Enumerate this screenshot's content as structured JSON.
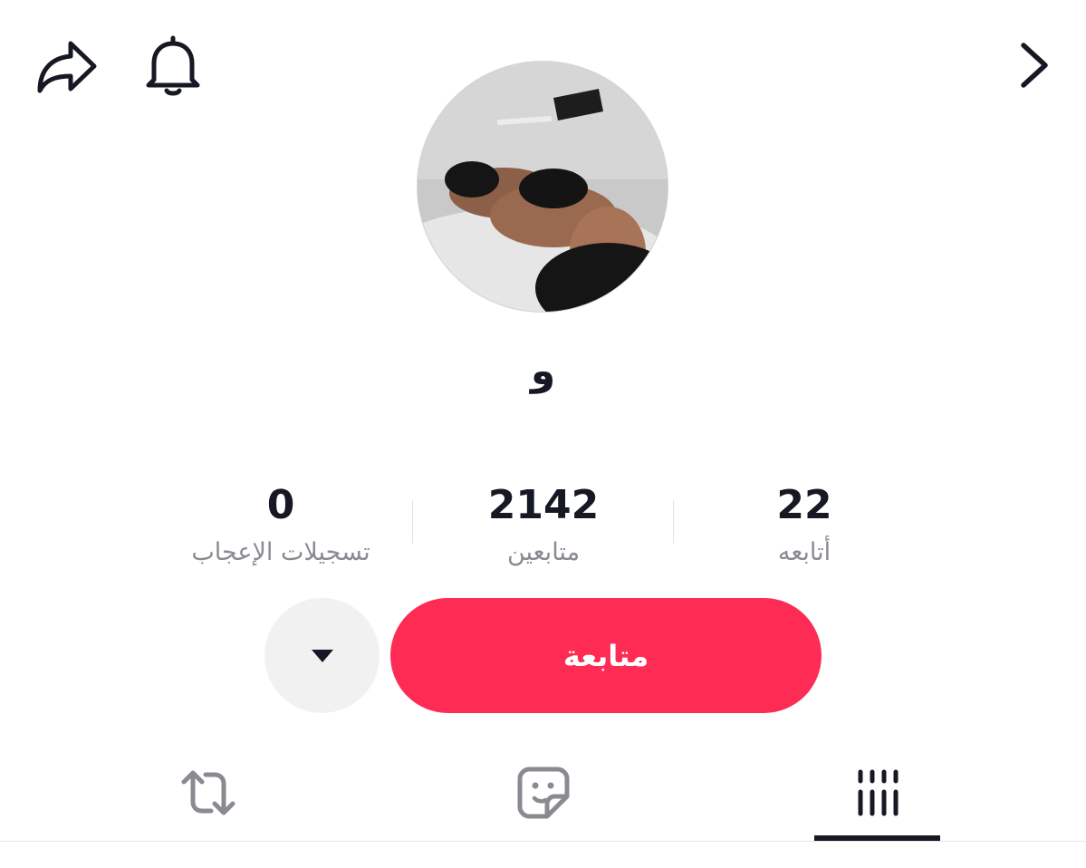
{
  "header": {
    "share_icon": "share-arrow-icon",
    "bell_icon": "bell-icon",
    "back_icon": "chevron-right-icon"
  },
  "profile": {
    "username": "و"
  },
  "stats": {
    "likes": {
      "value": "0",
      "label": "تسجيلات الإعجاب"
    },
    "followers": {
      "value": "2142",
      "label": "متابعين"
    },
    "following": {
      "value": "22",
      "label": "أتابعه"
    }
  },
  "actions": {
    "follow_label": "متابعة",
    "follow_color": "#fe2c55",
    "more_icon": "triangle-down-icon"
  },
  "tabs": [
    {
      "icon": "repost-icon",
      "selected": false
    },
    {
      "icon": "liked-sticker-icon",
      "selected": false
    },
    {
      "icon": "videos-grid-icon",
      "selected": true
    }
  ]
}
